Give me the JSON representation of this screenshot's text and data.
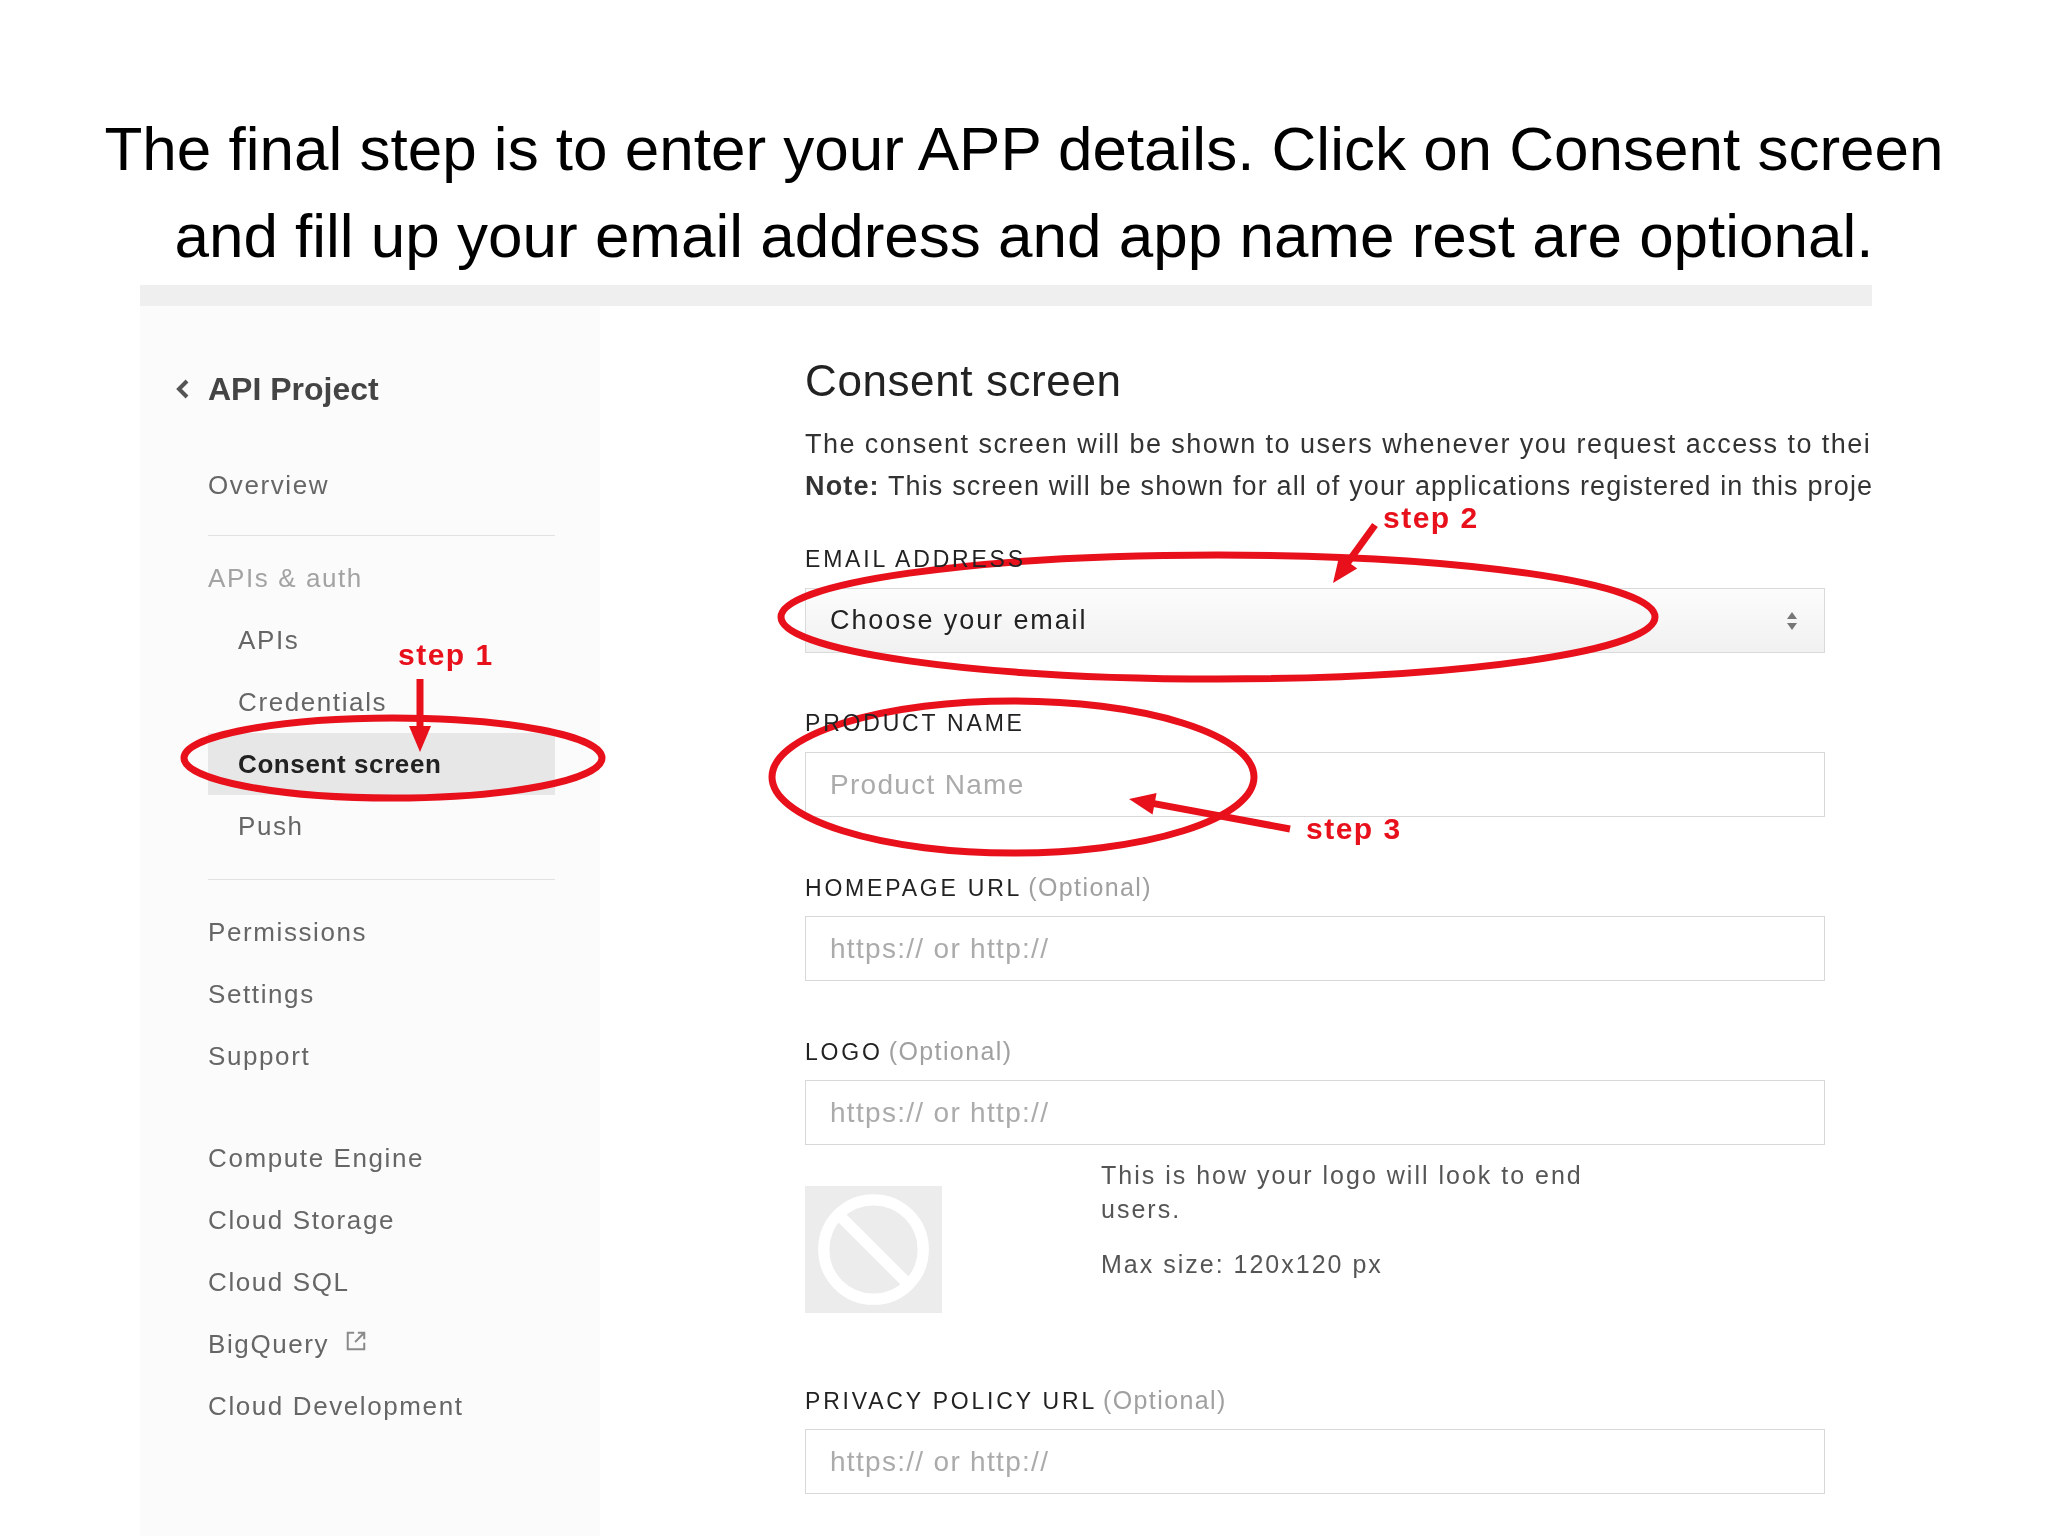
{
  "slide_title": "The final step is to enter your APP details. Click on Consent screen and fill up your email address and app name rest are optional.",
  "sidebar": {
    "project": "API Project",
    "sections": [
      {
        "ruled": true,
        "items": [
          {
            "label": "Overview",
            "selected": false
          }
        ]
      },
      {
        "ruled": true,
        "heading": "APIs & auth",
        "items": [
          {
            "label": "APIs",
            "selected": false
          },
          {
            "label": "Credentials",
            "selected": false
          },
          {
            "label": "Consent screen",
            "selected": true
          },
          {
            "label": "Push",
            "selected": false
          }
        ]
      },
      {
        "ruled": false,
        "items": [
          {
            "label": "Permissions",
            "selected": false
          },
          {
            "label": "Settings",
            "selected": false
          },
          {
            "label": "Support",
            "selected": false
          }
        ]
      },
      {
        "ruled": false,
        "items": [
          {
            "label": "Compute Engine",
            "selected": false,
            "external": false
          },
          {
            "label": "Cloud Storage",
            "selected": false,
            "external": false
          },
          {
            "label": "Cloud SQL",
            "selected": false,
            "external": false
          },
          {
            "label": "BigQuery",
            "selected": false,
            "external": true
          },
          {
            "label": "Cloud Development",
            "selected": false,
            "external": false
          }
        ]
      }
    ]
  },
  "form": {
    "title": "Consent screen",
    "description": "The consent screen will be shown to users whenever you request access to thei",
    "note": "**Note:** This screen will be shown for all of your applications registered in this proje",
    "fields": [
      {
        "kind": "select",
        "label": "EMAIL ADDRESS",
        "value": "Choose your email"
      },
      {
        "kind": "text",
        "label": "PRODUCT NAME",
        "placeholder": "Product Name"
      },
      {
        "kind": "text",
        "label": "HOMEPAGE URL",
        "optional": "(Optional)",
        "placeholder": "https:// or http://"
      },
      {
        "kind": "logo",
        "label": "LOGO",
        "optional": "(Optional)",
        "placeholder": "https:// or http://",
        "preview_note": "This is how your logo will look to end users.",
        "max_size": "Max size: 120x120 px"
      },
      {
        "kind": "text",
        "label": "PRIVACY POLICY URL",
        "optional": "(Optional)",
        "placeholder": "https:// or http://"
      }
    ]
  },
  "annotations": [
    {
      "label": "step 1"
    },
    {
      "label": "step 2"
    },
    {
      "label": "step 3"
    }
  ]
}
